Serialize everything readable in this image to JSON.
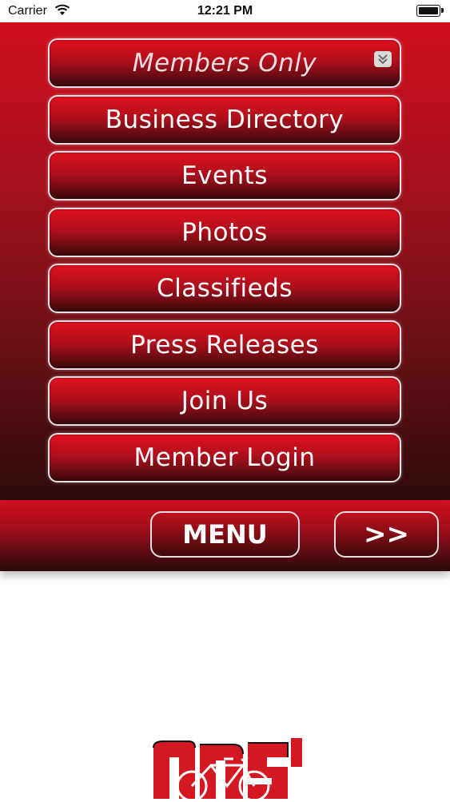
{
  "status_bar": {
    "carrier": "Carrier",
    "time": "12:21 PM"
  },
  "menu": {
    "items": [
      {
        "label": "Members Only"
      },
      {
        "label": "Business Directory"
      },
      {
        "label": "Events"
      },
      {
        "label": "Photos"
      },
      {
        "label": "Classifieds"
      },
      {
        "label": "Press Releases"
      },
      {
        "label": "Join Us"
      },
      {
        "label": "Member Login"
      }
    ]
  },
  "bottom_bar": {
    "menu_label": "MENU",
    "next_label": ">>"
  },
  "colors": {
    "primary_red": "#d10f1f",
    "dark_red": "#2e0b0d",
    "button_border": "#e6e0e6"
  },
  "icons": {
    "wifi": "wifi-icon",
    "battery": "battery-icon",
    "dropdown": "chevron-double-down-icon",
    "logo": "bicycle-logo"
  }
}
